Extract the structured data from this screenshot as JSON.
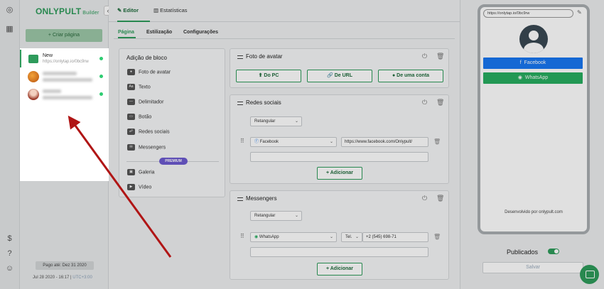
{
  "app": {
    "brand": "ONLYPULT",
    "brand_sub": "Builder"
  },
  "sidebar": {
    "create_label": "+ Criar página",
    "pages": [
      {
        "title": "New",
        "url": "https://onlytap.io/0bc9rw"
      }
    ],
    "paid_label": "Pago até: Dez 31 2020",
    "date": "Jul 28 2020 - 16:17",
    "timezone": "UTC+3:00"
  },
  "topbar": {
    "tab_editor": "Editor",
    "tab_stats": "Estatísticas"
  },
  "subtabs": {
    "page": "Página",
    "style": "Estilização",
    "settings": "Configurações"
  },
  "blocks": {
    "title": "Adição de bloco",
    "items": [
      "Foto de avatar",
      "Texto",
      "Delimitador",
      "Botão",
      "Redes sociais",
      "Messengers"
    ],
    "premium": "PREMIUM",
    "premium_items": [
      "Galeria",
      "Vídeo"
    ]
  },
  "avatar_card": {
    "title": "Foto de avatar",
    "btn_pc": "Do PC",
    "btn_url": "De URL",
    "btn_account": "De uma conta"
  },
  "social_card": {
    "title": "Redes sociais",
    "style_value": "Retangular",
    "network": "Facebook",
    "link": "https://www.facebook.com/Onlypult/",
    "add_label": "+ Adicionar"
  },
  "messengers_card": {
    "title": "Messengers",
    "style_value": "Retangular",
    "messenger": "WhatsApp",
    "phone_type": "Tel.",
    "phone": "+2 (545) 698-71",
    "add_label": "+ Adicionar"
  },
  "preview": {
    "url": "https://onlytap.io/0bc9rw",
    "facebook": "Facebook",
    "whatsapp": "WhatsApp",
    "developed": "Desenvolvido por onlypult.com",
    "published": "Publicados",
    "save": "Salvar",
    "colors": {
      "facebook": "#1877f2",
      "whatsapp": "#27ae60",
      "accent": "#2e9b5b"
    }
  }
}
